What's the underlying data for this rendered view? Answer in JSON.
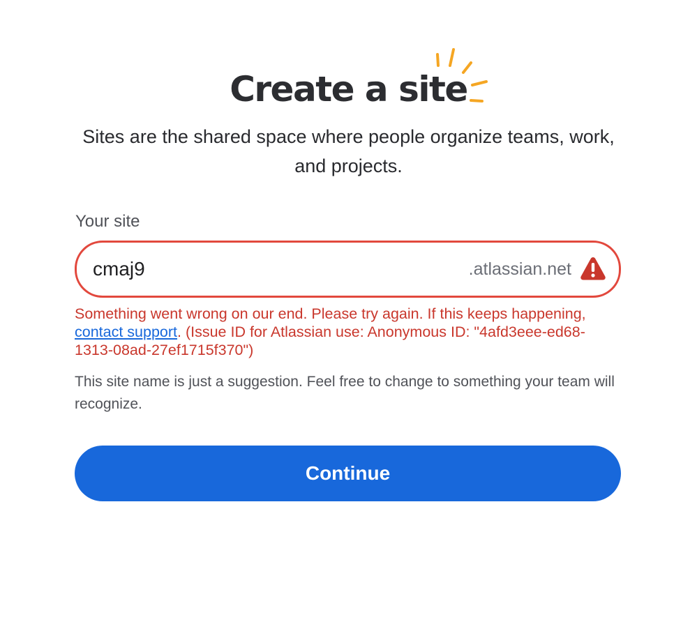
{
  "header": {
    "title": "Create a site",
    "subtitle": "Sites are the shared space where people organize teams, work, and projects."
  },
  "site_field": {
    "label": "Your site",
    "value": "cmaj9",
    "suffix": ".atlassian.net",
    "status_icon": "warning-icon"
  },
  "error": {
    "text_before_link": "Something went wrong on our end. Please try again. If this keeps happening, ",
    "link_text": "contact support",
    "text_after_link": ". (Issue ID for Atlassian use: Anonymous ID: \"4afd3eee-ed68-1313-08ad-27ef1715f370\")"
  },
  "helper_text": "This site name is just a suggestion. Feel free to change to something your team will recognize.",
  "actions": {
    "continue_label": "Continue"
  },
  "colors": {
    "primary": "#1868db",
    "error": "#c9372c",
    "error_border": "#e2483d",
    "sparkle": "#f5a623"
  }
}
